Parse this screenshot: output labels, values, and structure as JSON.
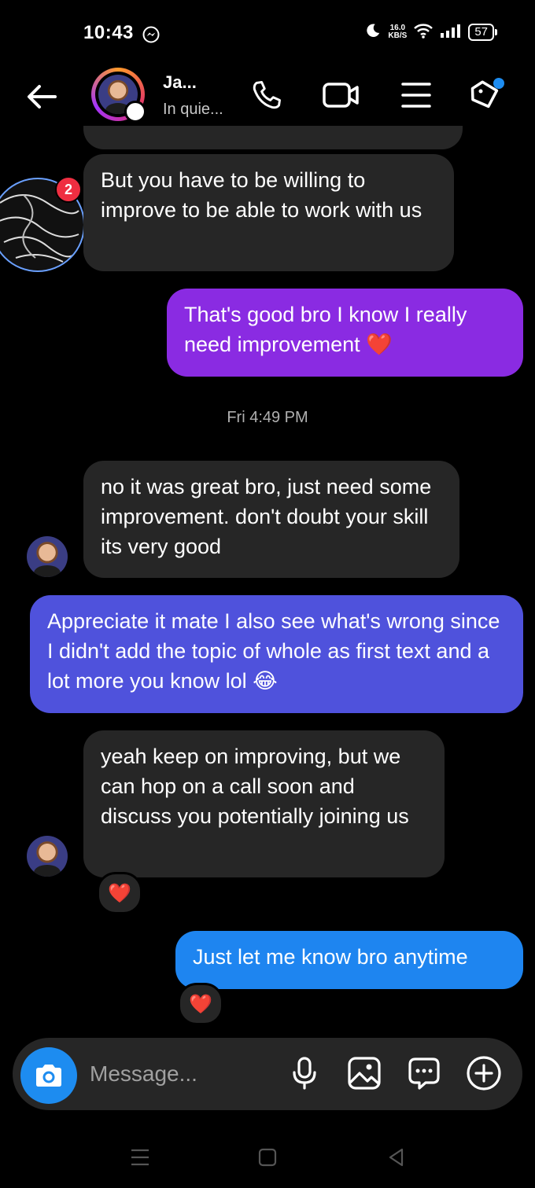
{
  "status_bar": {
    "time": "10:43",
    "network_speed_value": "16.0",
    "network_speed_unit": "KB/S",
    "battery": "57"
  },
  "header": {
    "name": "Ja...",
    "status": "In quie..."
  },
  "thread": {
    "partial_badge_count": "2",
    "messages": [
      {
        "from": "them",
        "text": "But you have to be willing to improve to be able to work with us"
      },
      {
        "from": "me",
        "text": "That's good bro I know I really need improvement ❤️"
      },
      {
        "from": "them",
        "text": "no it was great bro, just need some improvement. don't doubt your skill its very good"
      },
      {
        "from": "me",
        "text": "Appreciate it mate I also see what's wrong since I didn't add the topic of whole as first text and a lot more you know lol 😂"
      },
      {
        "from": "them",
        "text": "yeah keep on improving, but we can hop on a call soon and discuss you potentially joining us"
      },
      {
        "from": "me",
        "text": "Just let me know bro anytime"
      }
    ],
    "timestamp": "Fri 4:49 PM",
    "reaction": "❤️"
  },
  "composer": {
    "placeholder": "Message..."
  },
  "colors": {
    "sent_purple": "#8a2be2",
    "sent_indigo": "#4f52dc",
    "sent_blue": "#1e85f0",
    "received": "#262626",
    "camera": "#1d8cf0"
  }
}
